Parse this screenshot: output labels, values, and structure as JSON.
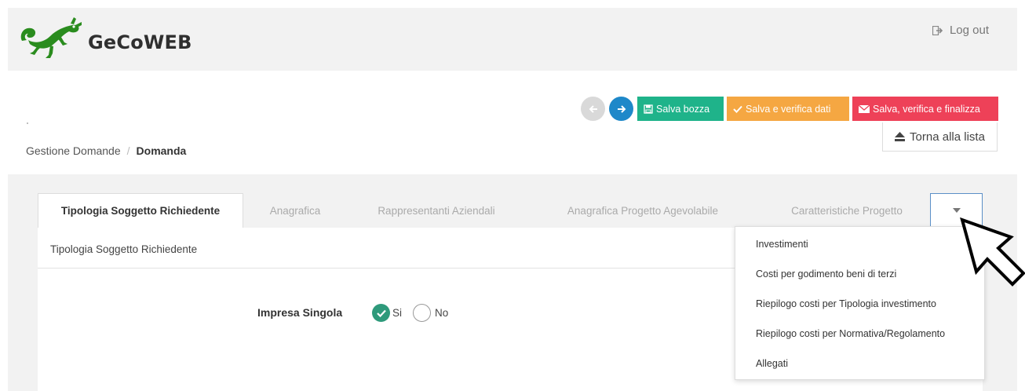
{
  "header": {
    "brand": "GeCoWEB",
    "logout_label": "Log out",
    "logo_icon": "gecko-logo-icon",
    "logo_color": "#2a8c1e"
  },
  "toolbar": {
    "save_draft_label": "Salva bozza",
    "save_verify_label": "Salva e verifica dati",
    "save_finalize_label": "Salva, verifica e finalizza",
    "back_label": "Torna alla lista",
    "colors": {
      "green": "#1fb38a",
      "orange": "#f5a742",
      "red": "#ee4158",
      "blue": "#1e88c9"
    }
  },
  "breadcrumb": {
    "parent": "Gestione Domande",
    "separator": "/",
    "current": "Domanda"
  },
  "tabs": [
    {
      "label": "Tipologia Soggetto Richiedente",
      "active": true
    },
    {
      "label": "Anagrafica",
      "active": false
    },
    {
      "label": "Rappresentanti Aziendali",
      "active": false
    },
    {
      "label": "Anagrafica Progetto Agevolabile",
      "active": false
    },
    {
      "label": "Caratteristiche Progetto",
      "active": false
    }
  ],
  "section": {
    "title": "Tipologia Soggetto Richiedente",
    "field_label": "Impresa Singola",
    "option_yes": "Si",
    "option_no": "No",
    "selected": "Si"
  },
  "dropdown_menu": {
    "items": [
      "Investimenti",
      "Costi per godimento beni di terzi",
      "Riepilogo costi per Tipologia investimento",
      "Riepilogo costi per Normativa/Regolamento",
      "Allegati"
    ]
  }
}
